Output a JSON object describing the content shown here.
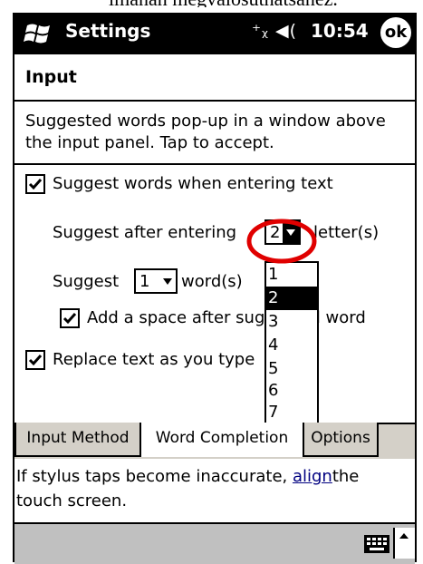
{
  "caption": "lmanan megvalosuthatsanez.",
  "title_bar": {
    "app_title": "Settings",
    "status_icons": "⁺ᵪ ◀(",
    "clock": "10:54",
    "ok_label": "ok"
  },
  "section": {
    "title": "Input",
    "description": "Suggested words pop-up in a window above\nthe input panel.  Tap to accept."
  },
  "options": {
    "suggest_words": {
      "label": "Suggest words when entering text",
      "checked": true
    },
    "suggest_after": {
      "prefix": "Suggest after entering",
      "value": "2",
      "suffix": "letter(s)"
    },
    "suggest_count": {
      "prefix": "Suggest",
      "value": "1",
      "suffix": "word(s)"
    },
    "add_space": {
      "label": "Add a space after suggested word",
      "checked": true
    },
    "replace_text": {
      "label": "Replace text as you type",
      "checked": true
    }
  },
  "dropdown": {
    "options": [
      "1",
      "2",
      "3",
      "4",
      "5",
      "6",
      "7"
    ],
    "selected": "2"
  },
  "tabs": [
    "Input Method",
    "Word Completion",
    "Options"
  ],
  "active_tab": "Word Completion",
  "footer": {
    "text_before": "If stylus taps become inaccurate, ",
    "link": "align",
    "text_after": "the touch screen."
  },
  "icons": [
    "windows-start-icon",
    "connectivity-icon",
    "volume-icon",
    "keyboard-icon",
    "input-arrow-icon"
  ],
  "colors": {
    "highlight_ring": "#e00000",
    "selection": "#000000",
    "tab_bar": "#d4d0c8"
  }
}
